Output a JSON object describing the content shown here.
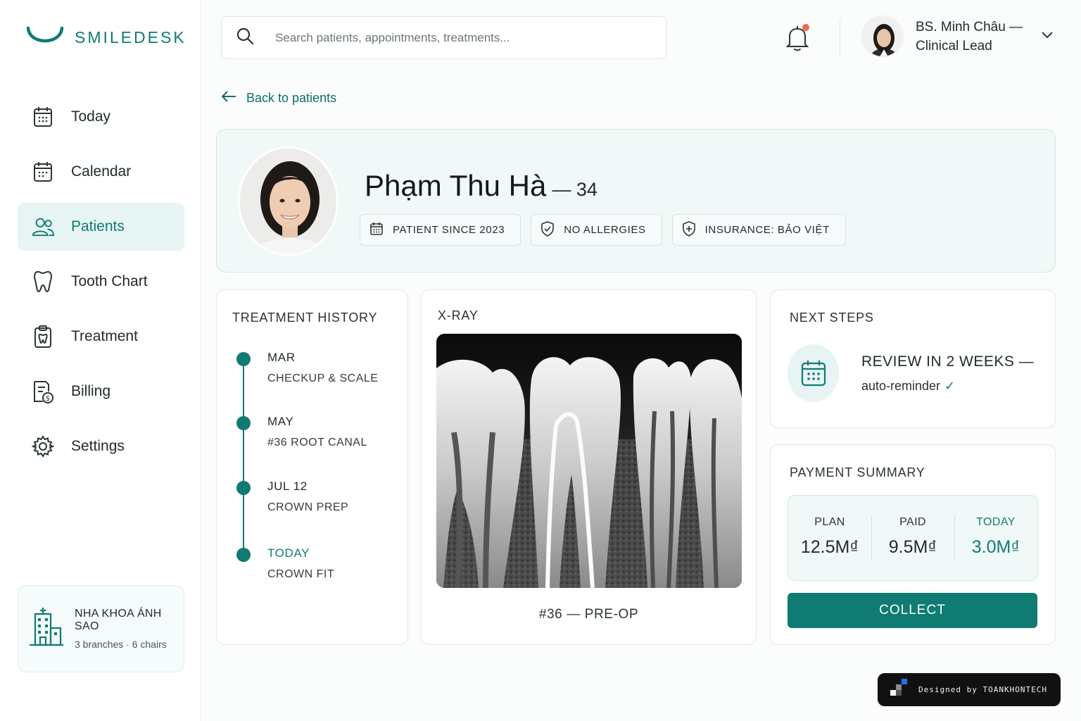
{
  "app": {
    "name": "SMILEDESK",
    "accent": "#0f7b73",
    "accent_light": "#e6f4f3"
  },
  "sidebar": {
    "items": [
      {
        "label": "Today",
        "icon": "calendar-grid-icon",
        "active": false
      },
      {
        "label": "Calendar",
        "icon": "calendar-icon",
        "active": false
      },
      {
        "label": "Patients",
        "icon": "users-icon",
        "active": true
      },
      {
        "label": "Tooth Chart",
        "icon": "tooth-icon",
        "active": false
      },
      {
        "label": "Treatment",
        "icon": "clipboard-tooth-icon",
        "active": false
      },
      {
        "label": "Billing",
        "icon": "invoice-dollar-icon",
        "active": false
      },
      {
        "label": "Settings",
        "icon": "gear-icon",
        "active": false
      }
    ],
    "clinic": {
      "name": "NHA KHOA ÁNH SAO",
      "details": "3 branches · 6 chairs",
      "icon": "hospital-icon"
    }
  },
  "header": {
    "search_placeholder": "Search patients, appointments, treatments...",
    "notifications_unread": true,
    "user": {
      "name": "BS. Minh Châu — Clinical Lead"
    }
  },
  "back_link": "Back to patients",
  "patient": {
    "name": "Phạm Thu Hà",
    "age": "— 34",
    "chips": [
      {
        "label": "PATIENT SINCE 2023",
        "icon": "calendar-icon"
      },
      {
        "label": "NO ALLERGIES",
        "icon": "shield-check-icon"
      },
      {
        "label": "INSURANCE: BẢO VIỆT",
        "icon": "shield-plus-icon"
      }
    ]
  },
  "treatment_history": {
    "title": "TREATMENT HISTORY",
    "items": [
      {
        "date": "MAR",
        "procedure": "CHECKUP & SCALE"
      },
      {
        "date": "MAY",
        "procedure": "#36 ROOT CANAL"
      },
      {
        "date": "JUL 12",
        "procedure": "CROWN PREP"
      },
      {
        "date": "TODAY",
        "procedure": "CROWN FIT"
      }
    ]
  },
  "xray": {
    "title": "X-RAY",
    "caption": "#36 — PRE-OP"
  },
  "next_steps": {
    "title": "NEXT STEPS",
    "main": "REVIEW IN 2 WEEKS —",
    "sub": "auto-reminder",
    "check": "✓"
  },
  "payment": {
    "title": "PAYMENT SUMMARY",
    "columns": [
      {
        "label": "PLAN",
        "value": "12.5M₫"
      },
      {
        "label": "PAID",
        "value": "9.5M₫"
      },
      {
        "label": "TODAY",
        "value": "3.0M₫"
      }
    ],
    "action": "COLLECT"
  },
  "credit": "Designed by TOANKHONTECH"
}
